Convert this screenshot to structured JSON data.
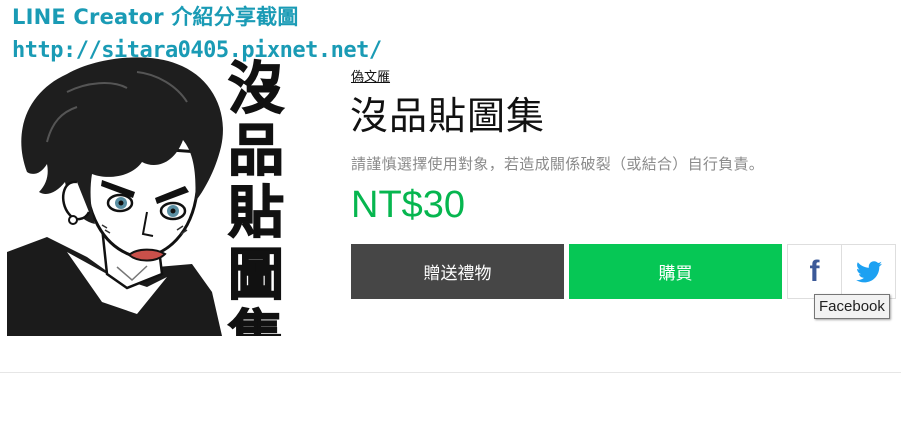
{
  "watermark": {
    "line1": "LINE Creator 介紹分享截圖",
    "line2": "http://sitara0405.pixnet.net/",
    "color": "#1a9bb5"
  },
  "sticker": {
    "vertical_title": [
      "沒",
      "品",
      "貼",
      "圖",
      "集"
    ]
  },
  "product": {
    "creator": "偽文雁",
    "title": "沒品貼圖集",
    "description": "請謹慎選擇使用對象，若造成關係破裂（或結合）自行負責。",
    "price": "NT$30",
    "price_color": "#06b64f"
  },
  "actions": {
    "gift_label": "贈送禮物",
    "buy_label": "購買",
    "gift_color": "#464646",
    "buy_color": "#06c755"
  },
  "share": {
    "facebook_icon": "facebook-icon",
    "twitter_icon": "twitter-icon",
    "tooltip": "Facebook"
  }
}
